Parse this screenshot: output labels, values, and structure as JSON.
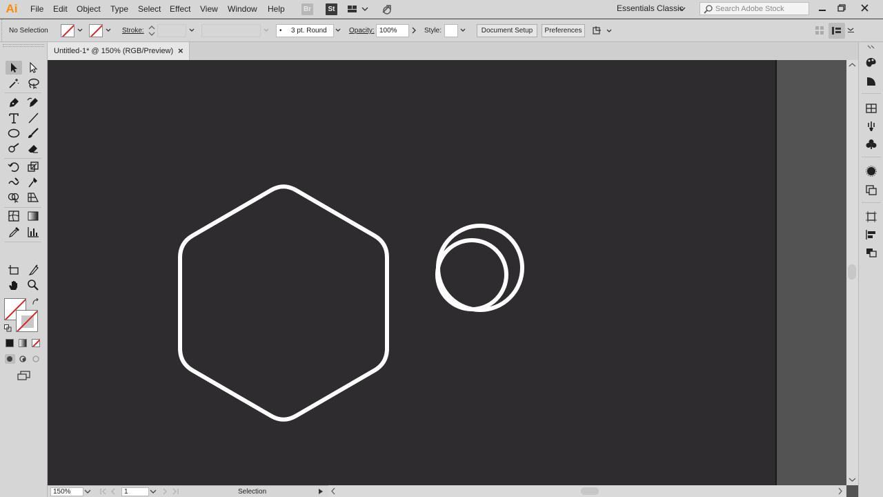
{
  "app": {
    "logo": "Ai",
    "menus": [
      "File",
      "Edit",
      "Object",
      "Type",
      "Select",
      "Effect",
      "View",
      "Window",
      "Help"
    ],
    "bridge_badge": "Br",
    "stock_badge": "St",
    "workspace": "Essentials Classic",
    "search_placeholder": "Search Adobe Stock"
  },
  "control_bar": {
    "selection": "No Selection",
    "stroke_label": "Stroke:",
    "brush": "3 pt. Round",
    "opacity_label": "Opacity:",
    "opacity": "100%",
    "style_label": "Style:",
    "document_setup": "Document Setup",
    "preferences": "Preferences"
  },
  "document": {
    "tab_title": "Untitled-1* @ 150% (RGB/Preview)",
    "close_glyph": "×"
  },
  "status": {
    "zoom": "150%",
    "artboard": "1",
    "tool": "Selection"
  },
  "colors": {
    "artboard_bg": "#2e2c2e",
    "stroke": "#ffffff",
    "logo_orange": "#ff8a00",
    "ui_gray": "#d6d6d6"
  },
  "tools": [
    "selection-tool-icon",
    "direct-selection-tool-icon",
    "magic-wand-tool-icon",
    "lasso-tool-icon",
    "pen-tool-icon",
    "curvature-tool-icon",
    "type-tool-icon",
    "line-segment-tool-icon",
    "ellipse-tool-icon",
    "paintbrush-tool-icon",
    "shaper-tool-icon",
    "eraser-tool-icon",
    "rotate-tool-icon",
    "scale-tool-icon",
    "warp-tool-icon",
    "puppet-warp-tool-icon",
    "shape-builder-tool-icon",
    "perspective-grid-tool-icon",
    "mesh-tool-icon",
    "gradient-tool-icon",
    "eyedropper-tool-icon",
    "graph-tool-icon",
    "artboard-tool-icon",
    "slice-tool-icon",
    "hand-tool-icon",
    "zoom-tool-icon"
  ],
  "dock_icons": [
    "color-panel-icon",
    "color-guide-panel-icon",
    "swatches-panel-icon",
    "brushes-panel-icon",
    "symbols-panel-icon",
    "appearance-panel-icon",
    "graphic-styles-panel-icon",
    "transform-panel-icon",
    "align-panel-icon",
    "pathfinder-panel-icon"
  ]
}
